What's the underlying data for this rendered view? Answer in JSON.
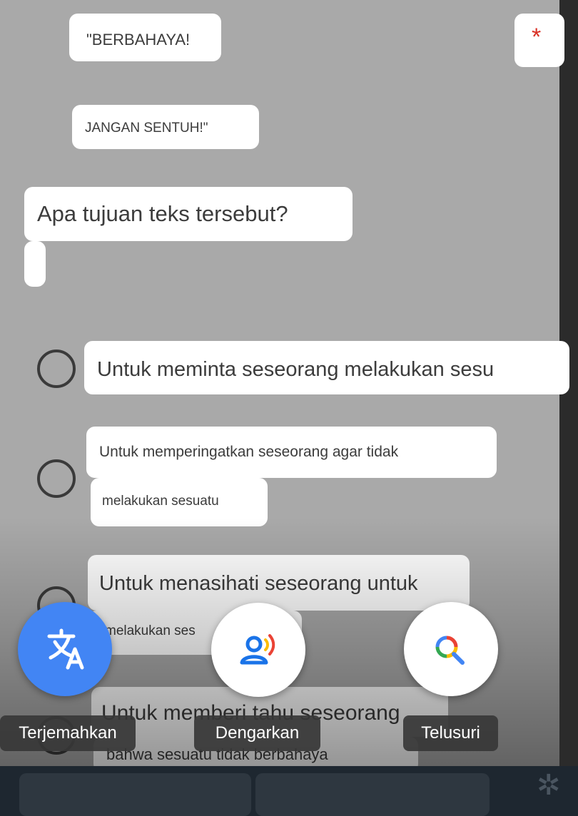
{
  "question_block": {
    "line1": "\"BERBAHAYA!",
    "line2": "JANGAN SENTUH!\"",
    "required_marker": "*",
    "question": "Apa tujuan teks tersebut?"
  },
  "options": [
    {
      "line1": "Untuk meminta seseorang melakukan sesu"
    },
    {
      "line1": "Untuk memperingatkan seseorang agar tidak",
      "line2": "melakukan sesuatu"
    },
    {
      "line1": "Untuk menasihati seseorang untuk",
      "line2": "melakukan ses"
    },
    {
      "line1": "Untuk memberi tahu seseorang",
      "line2": "bahwa sesuatu tidak berbahaya"
    }
  ],
  "lens_actions": [
    {
      "label": "Terjemahkan",
      "icon": "translate-icon"
    },
    {
      "label": "Dengarkan",
      "icon": "listen-icon"
    },
    {
      "label": "Telusuri",
      "icon": "search-icon"
    }
  ],
  "colors": {
    "background": "#a9a9a9",
    "translate_button": "#4285f4",
    "required_star": "#d93025",
    "bottom_bar": "#1e2730"
  }
}
